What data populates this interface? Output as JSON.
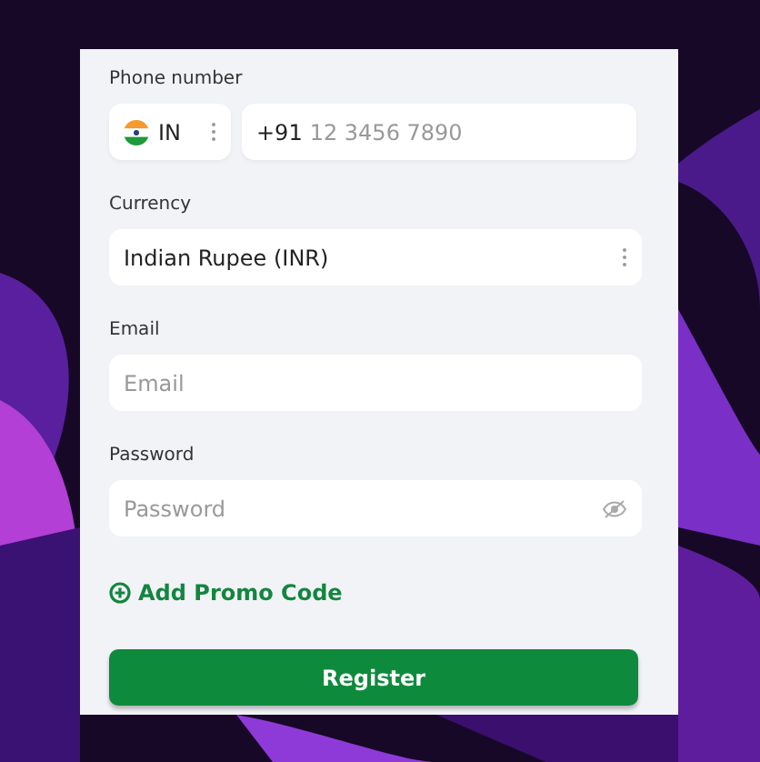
{
  "form": {
    "phone": {
      "label": "Phone number",
      "country": "IN",
      "prefix": "+91",
      "placeholder": "12 3456 7890"
    },
    "currency": {
      "label": "Currency",
      "value": "Indian Rupee (INR)"
    },
    "email": {
      "label": "Email",
      "placeholder": "Email"
    },
    "password": {
      "label": "Password",
      "placeholder": "Password"
    },
    "promo_link": "Add Promo Code",
    "submit": "Register"
  }
}
